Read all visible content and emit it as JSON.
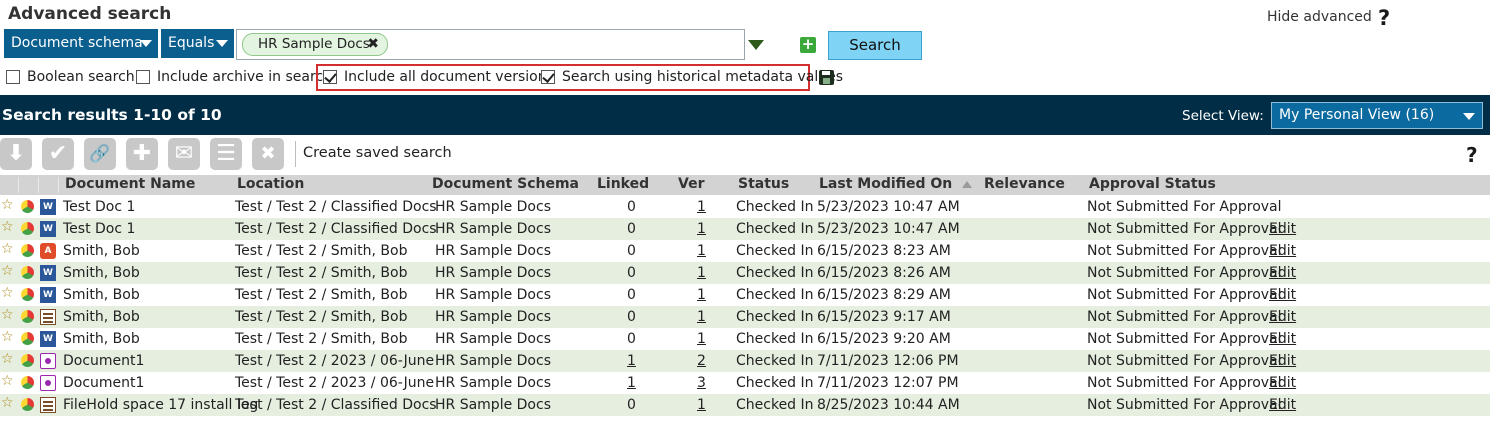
{
  "advanced": {
    "title": "Advanced search",
    "hide_label": "Hide advanced",
    "help_label": "?",
    "field_select": "Document schema",
    "operator_select": "Equals",
    "tag_value": "HR Sample Docs",
    "tag_remove": "✖",
    "add_label": "+",
    "search_button": "Search",
    "options": [
      {
        "label": "Boolean search",
        "checked": false
      },
      {
        "label": "Include archive in search",
        "checked": false
      },
      {
        "label": "Include all document versions",
        "checked": true
      },
      {
        "label": "Search using historical metadata values",
        "checked": true
      }
    ]
  },
  "results": {
    "title": "Search results 1-10 of 10",
    "view_label": "Select View:",
    "view_value": "My Personal View (16)"
  },
  "toolbar": {
    "buttons": [
      {
        "icon": "download-icon",
        "glyph": "⬇"
      },
      {
        "icon": "checkmark-icon",
        "glyph": "✔"
      },
      {
        "icon": "link-icon",
        "glyph": "🔗"
      },
      {
        "icon": "puzzle-icon",
        "glyph": "✚"
      },
      {
        "icon": "envelope-icon",
        "glyph": "✉"
      },
      {
        "icon": "document-list-icon",
        "glyph": "☰"
      },
      {
        "icon": "close-icon",
        "glyph": "✖"
      }
    ],
    "create_saved": "Create saved search",
    "help_label": "?"
  },
  "table": {
    "columns": [
      "Document Name",
      "Location",
      "Document Schema",
      "Linked",
      "Ver",
      "Status",
      "Last Modified On",
      "Relevance",
      "Approval Status"
    ],
    "rows": [
      {
        "icon": "word-icon",
        "name": "Test Doc 1",
        "location": "Test / Test 2 / Classified Docs",
        "schema": "HR Sample Docs",
        "linked": "0",
        "ver": "1",
        "status": "Checked In",
        "modified": "5/23/2023 10:47 AM",
        "approval": "Not Submitted For Approval",
        "edit": ""
      },
      {
        "icon": "word-icon",
        "name": "Test Doc 1",
        "location": "Test / Test 2 / Classified Docs",
        "schema": "HR Sample Docs",
        "linked": "0",
        "ver": "1",
        "status": "Checked In",
        "modified": "5/23/2023 10:47 AM",
        "approval": "Not Submitted For Approval",
        "edit": "Edit"
      },
      {
        "icon": "pdf-icon",
        "name": "Smith, Bob",
        "location": "Test / Test 2 / Smith, Bob",
        "schema": "HR Sample Docs",
        "linked": "0",
        "ver": "1",
        "status": "Checked In",
        "modified": "6/15/2023 8:23 AM",
        "approval": "Not Submitted For Approval",
        "edit": "Edit"
      },
      {
        "icon": "word-icon",
        "name": "Smith, Bob",
        "location": "Test / Test 2 / Smith, Bob",
        "schema": "HR Sample Docs",
        "linked": "0",
        "ver": "1",
        "status": "Checked In",
        "modified": "6/15/2023 8:26 AM",
        "approval": "Not Submitted For Approval",
        "edit": "Edit"
      },
      {
        "icon": "word-icon",
        "name": "Smith, Bob",
        "location": "Test / Test 2 / Smith, Bob",
        "schema": "HR Sample Docs",
        "linked": "0",
        "ver": "1",
        "status": "Checked In",
        "modified": "6/15/2023 8:29 AM",
        "approval": "Not Submitted For Approval",
        "edit": "Edit"
      },
      {
        "icon": "text-file-icon",
        "name": "Smith, Bob",
        "location": "Test / Test 2 / Smith, Bob",
        "schema": "HR Sample Docs",
        "linked": "0",
        "ver": "1",
        "status": "Checked In",
        "modified": "6/15/2023 9:17 AM",
        "approval": "Not Submitted For Approval",
        "edit": "Edit"
      },
      {
        "icon": "word-icon",
        "name": "Smith, Bob",
        "location": "Test / Test 2 / Smith, Bob",
        "schema": "HR Sample Docs",
        "linked": "0",
        "ver": "1",
        "status": "Checked In",
        "modified": "6/15/2023 9:20 AM",
        "approval": "Not Submitted For Approval",
        "edit": "Edit"
      },
      {
        "icon": "generic-file-icon",
        "name": "Document1",
        "location": "Test / Test 2 / 2023 / 06-June",
        "schema": "HR Sample Docs",
        "linked": "1",
        "ver": "2",
        "status": "Checked In",
        "modified": "7/11/2023 12:06 PM",
        "approval": "Not Submitted For Approval",
        "edit": "Edit"
      },
      {
        "icon": "generic-file-icon",
        "name": "Document1",
        "location": "Test / Test 2 / 2023 / 06-June",
        "schema": "HR Sample Docs",
        "linked": "1",
        "ver": "3",
        "status": "Checked In",
        "modified": "7/11/2023 12:07 PM",
        "approval": "Not Submitted For Approval",
        "edit": "Edit"
      },
      {
        "icon": "text-file-icon",
        "name": "FileHold space 17 install log",
        "location": "Test / Test 2 / Classified Docs",
        "schema": "HR Sample Docs",
        "linked": "0",
        "ver": "1",
        "status": "Checked In",
        "modified": "8/25/2023 10:44 AM",
        "approval": "Not Submitted For Approval",
        "edit": "Edit"
      }
    ]
  },
  "colors": {
    "header_bar": "#012e46",
    "select_blue": "#0b5f8e",
    "search_button": "#7fd3f4",
    "alt_row": "#e6eee0",
    "highlight_box": "#d32f2f"
  }
}
